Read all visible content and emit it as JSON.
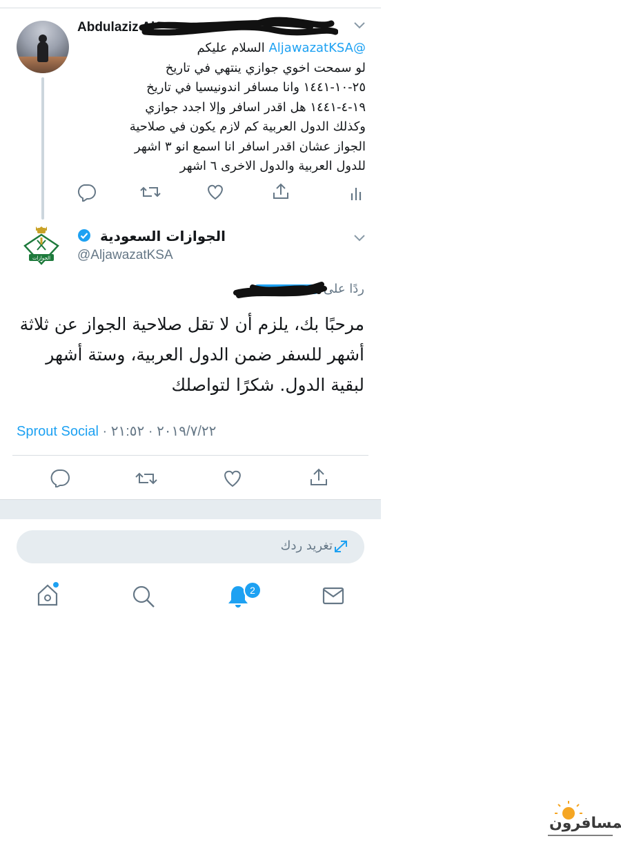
{
  "tweet1": {
    "display_name": "Abdulaziz Al",
    "mention": "@AljawazatKSA",
    "greeting": "السلام عليكم",
    "lines": [
      "لو سمحت اخوي جوازي ينتهي في تاريخ",
      "٢٥-١٠-١٤٤١ وانا مسافر اندونيسيا في تاريخ",
      "١٩-٤-١٤٤١ هل اقدر اسافر وإلا اجدد جوازي",
      "وكذلك الدول العربية كم لازم يكون في صلاحية",
      "الجواز عشان اقدر اسافر  انا اسمع انو ٣ اشهر",
      "للدول العربية والدول الاخرى ٦ اشهر"
    ]
  },
  "tweet2": {
    "display_name": "الجوازات السعودية",
    "handle": "@AljawazatKSA",
    "replying_to": "ردًا على",
    "text": "مرحبًا بك، يلزم أن لا تقل صلاحية الجواز عن ثلاثة أشهر للسفر ضمن الدول العربية، وستة أشهر لبقية الدول. شكرًا لتواصلك",
    "source": "Sprout Social",
    "datetime": " · ٢٠١٩/٧/٢٢ · ٢١:٥٢",
    "logo_text": "الجوازات"
  },
  "reply_box": {
    "placeholder": "تغريد ردك"
  },
  "bottom_nav": {
    "notifications_badge": "2"
  },
  "watermark": {
    "text": "المسافرون"
  },
  "colors": {
    "accent": "#1da1f2",
    "muted": "#657786",
    "divider": "#e6ecf0"
  },
  "icons": [
    "reply-icon",
    "retweet-icon",
    "like-icon",
    "share-icon",
    "analytics-icon",
    "verified-badge-icon",
    "expand-icon",
    "home-icon",
    "search-icon",
    "notifications-bell-icon",
    "messages-icon",
    "chevron-down-icon"
  ]
}
